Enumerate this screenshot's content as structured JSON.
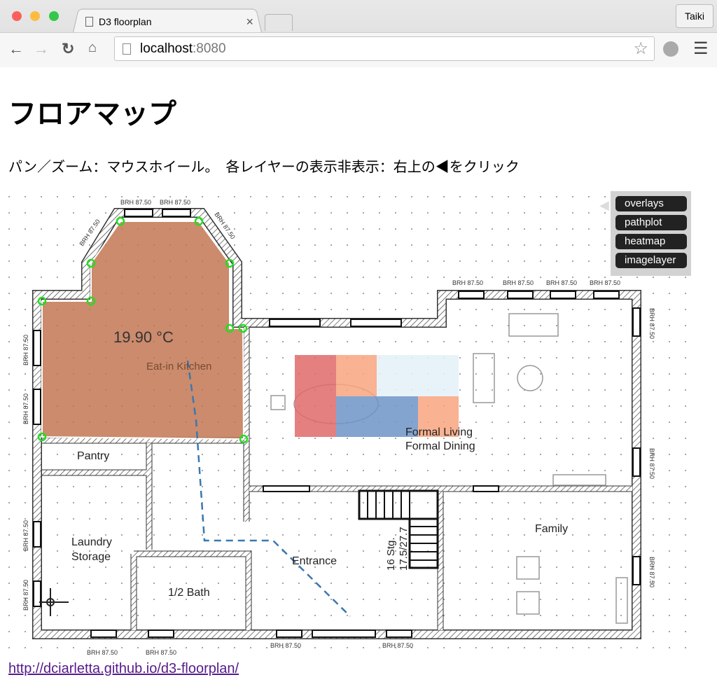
{
  "browser": {
    "tab_title": "D3 floorplan",
    "tab_close": "×",
    "profile": "Taiki",
    "url_host": "localhost",
    "url_port": ":8080"
  },
  "page": {
    "title": "フロアマップ",
    "instructions": "パン／ズーム：マウスホイール。　各レイヤーの表示非表示：右上の◀をクリック",
    "link": "http://dciarletta.github.io/d3-floorplan/"
  },
  "layers": {
    "toggle": "◀",
    "items": [
      "overlays",
      "pathplot",
      "heatmap",
      "imagelayer"
    ]
  },
  "overlay": {
    "temperature": "19.90 °C",
    "fill_color": "#c0724c",
    "vertex_color": "#22dd22"
  },
  "rooms": {
    "kitchen": "Eat-in Kitchen",
    "pantry": "Pantry",
    "laundry": "Laundry",
    "storage": "Storage",
    "bath": "1/2 Bath",
    "entrance": "Entrance",
    "formal_living": "Formal Living",
    "formal_dining": "Formal Dining",
    "family": "Family",
    "stairs_1": "16 Stg.",
    "stairs_2": "17.5/27.7"
  },
  "window_label": "BRH 87.50",
  "heatmap": {
    "colors": {
      "hot": "#e06b6b",
      "warm": "#f9a57f",
      "cool": "#6f95c8",
      "cold": "#e4f2f9"
    }
  },
  "pathplot": {
    "color": "#3a78b0"
  }
}
